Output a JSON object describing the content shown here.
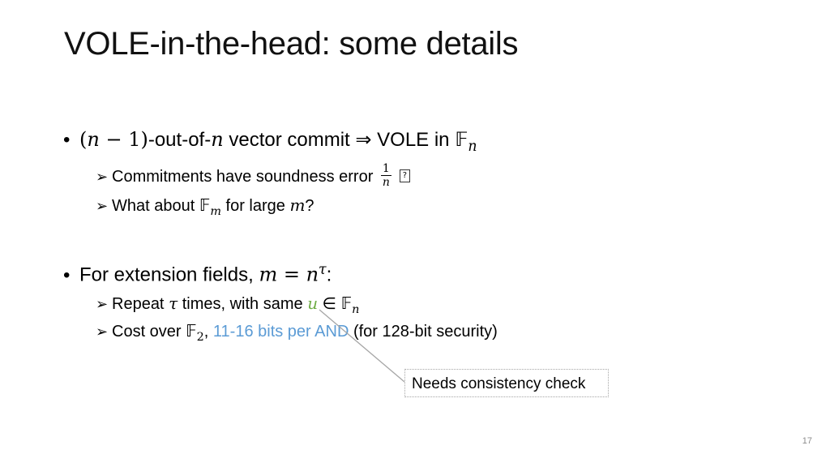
{
  "slide": {
    "title": "VOLE-in-the-head: some details",
    "page_number": "17",
    "colors": {
      "variable_u": "#70ad47",
      "highlight_cost": "#5b9bd5",
      "callout_border": "#a6a6a6",
      "connector": "#a6a6a6"
    },
    "bullets": [
      {
        "marker": "•",
        "prefix_math": "(n − 1)",
        "text_a": "-out-of-",
        "var_n": "n",
        "text_b": " vector commit ⇒ VOLE in ",
        "field": "𝔽",
        "field_sub": "n",
        "subitems": [
          {
            "marker": "➢",
            "text": "Commitments have soundness error ",
            "frac_num": "1",
            "frac_den": "n",
            "trailing_glyph": "?"
          },
          {
            "marker": "➢",
            "text_a": "What about ",
            "field": "𝔽",
            "field_sub": "m",
            "text_b": " for large ",
            "var": "m",
            "text_c": "?"
          }
        ]
      },
      {
        "marker": "•",
        "text_a": "For extension fields, ",
        "math": "m = n",
        "math_sup": "τ",
        "text_b": ":",
        "subitems": [
          {
            "marker": "➢",
            "text_a": "Repeat ",
            "var_tau": "τ",
            "text_b": " times, with same ",
            "var_u": "u",
            "elem": " ∈ ",
            "field": "𝔽",
            "field_sub": "n"
          },
          {
            "marker": "➢",
            "text_a": "Cost over ",
            "field": "𝔽",
            "field_sub": "2",
            "text_b": ", ",
            "highlight": "11-16 bits per AND",
            "text_c": " (for 128-bit security)"
          }
        ]
      }
    ],
    "callout": {
      "text": "Needs consistency check"
    }
  }
}
